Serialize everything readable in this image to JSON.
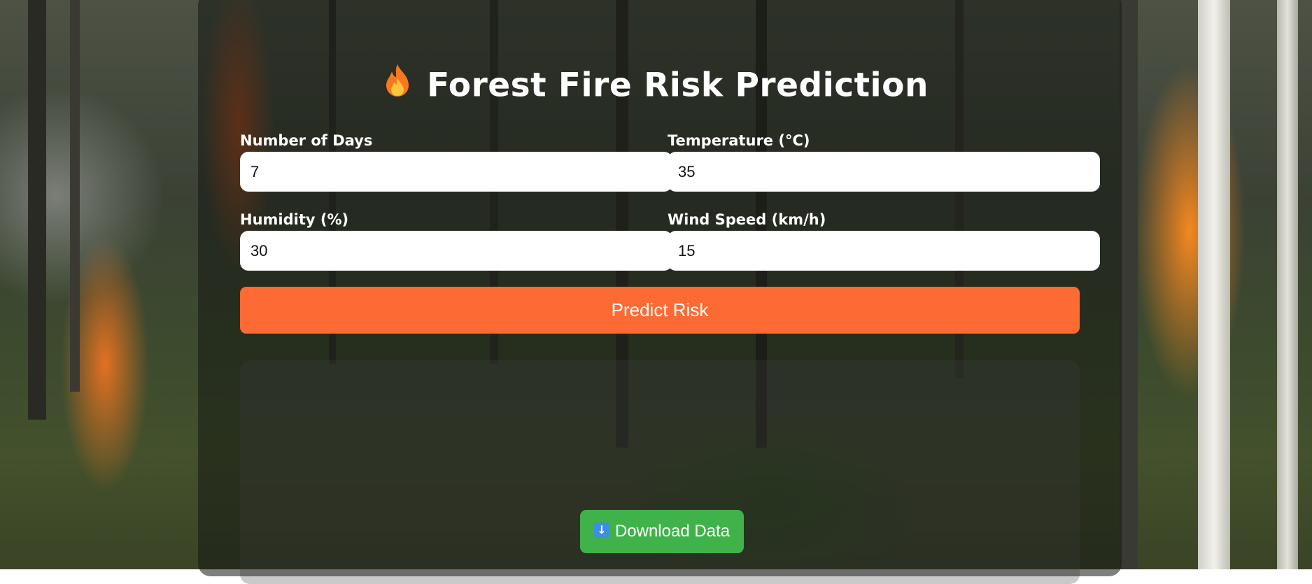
{
  "header": {
    "title": "Forest Fire Risk Prediction",
    "icon": "fire-icon"
  },
  "form": {
    "days": {
      "label": "Number of Days",
      "value": "7"
    },
    "temperature": {
      "label": "Temperature (°C)",
      "value": "35"
    },
    "humidity": {
      "label": "Humidity (%)",
      "value": "30"
    },
    "wind": {
      "label": "Wind Speed (km/h)",
      "value": "15"
    },
    "predict_label": "Predict Risk"
  },
  "result": {
    "download_label": "Download Data",
    "download_icon": "down-arrow-icon"
  },
  "colors": {
    "predict_button": "#fe6a33",
    "download_button": "#3fb34a",
    "input_background": "#ffffff"
  }
}
